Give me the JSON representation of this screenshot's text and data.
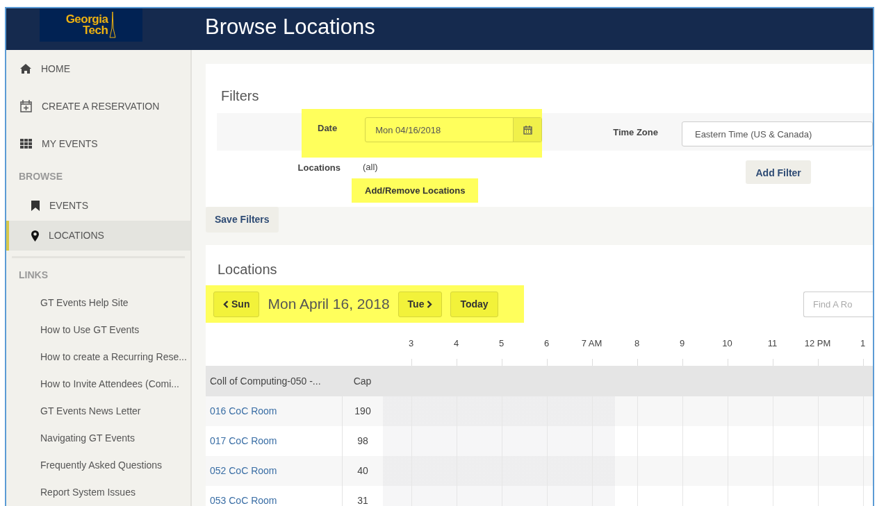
{
  "header": {
    "logo": {
      "line1": "Georgia",
      "line2": "Tech"
    },
    "title": "Browse Locations"
  },
  "sidebar": {
    "nav": [
      {
        "label": "HOME",
        "selected": false
      },
      {
        "label": "CREATE A RESERVATION",
        "selected": false
      },
      {
        "label": "MY EVENTS",
        "selected": false
      }
    ],
    "sections": [
      {
        "title": "BROWSE",
        "items": [
          {
            "label": "EVENTS",
            "selected": false
          },
          {
            "label": "LOCATIONS",
            "selected": true
          }
        ]
      },
      {
        "title": "LINKS",
        "items": [
          {
            "label": "GT Events Help Site",
            "selected": false
          },
          {
            "label": "How to Use GT Events",
            "selected": false
          },
          {
            "label": "How to create a Recurring Rese...",
            "selected": false
          },
          {
            "label": "How to Invite Attendees (Comi...",
            "selected": false
          },
          {
            "label": "GT Events News Letter",
            "selected": false
          },
          {
            "label": "Navigating GT Events",
            "selected": false
          },
          {
            "label": "Frequently Asked Questions",
            "selected": false
          },
          {
            "label": "Report System Issues",
            "selected": false
          }
        ]
      }
    ]
  },
  "filters": {
    "title": "Filters",
    "date": {
      "label": "Date",
      "value": "Mon 04/16/2018",
      "highlighted": true
    },
    "time_zone": {
      "label": "Time Zone",
      "value": "Eastern Time (US & Canada)"
    },
    "locations": {
      "label": "Locations",
      "value": "(all)",
      "link": "Add/Remove Locations",
      "highlighted": true
    },
    "add_filter": "Add Filter",
    "save": "Save Filters"
  },
  "locations": {
    "title": "Locations",
    "nav": {
      "prev": "Sun",
      "date": "Mon April 16, 2018",
      "next": "Tue",
      "today": "Today",
      "highlighted": true
    },
    "search": {
      "placeholder": "Find A Ro"
    },
    "hours": [
      "3",
      "4",
      "5",
      "6",
      "7 AM",
      "8",
      "9",
      "10",
      "11",
      "12 PM",
      "1"
    ],
    "table": {
      "columns": [
        "Coll of Computing-050 -...",
        "Cap"
      ],
      "rows": [
        {
          "name": "016 CoC Room",
          "cap": "190"
        },
        {
          "name": "017 CoC Room",
          "cap": "98"
        },
        {
          "name": "052 CoC Room",
          "cap": "40"
        },
        {
          "name": "053 CoC Room",
          "cap": "31"
        }
      ]
    }
  }
}
